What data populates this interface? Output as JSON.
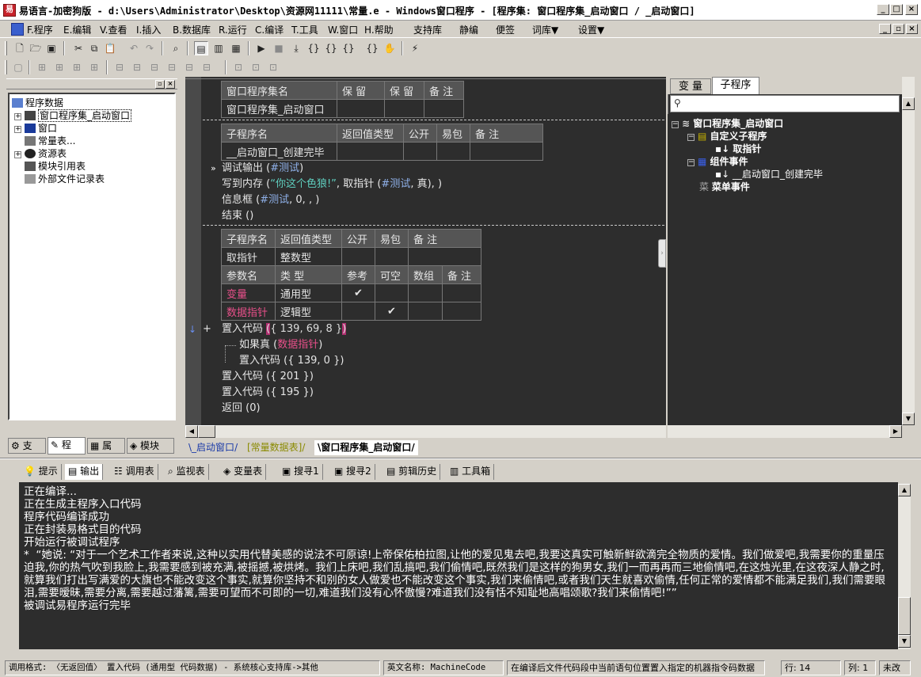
{
  "window": {
    "title": "易语言-加密狗版 - d:\\Users\\Administrator\\Desktop\\资源网11111\\常量.e - Windows窗口程序 - [程序集: 窗口程序集_启动窗口 / _启动窗口]"
  },
  "menu": [
    "F.程序",
    "E.编辑",
    "V.查看",
    "I.插入",
    "B.数据库",
    "R.运行",
    "C.编译",
    "T.工具",
    "W.窗口",
    "H.帮助",
    "支持库",
    "静编",
    "便签",
    "词库▼",
    "设置▼"
  ],
  "left_panel": {
    "tree": {
      "root": "程序数据",
      "items": [
        "窗口程序集_启动窗口",
        "窗口",
        "常量表...",
        "资源表",
        "模块引用表",
        "外部文件记录表"
      ]
    },
    "tabs": [
      "支",
      "程",
      "属",
      "模块"
    ]
  },
  "editor": {
    "class_table": {
      "headers": [
        "窗口程序集名",
        "保 留",
        "保 留",
        "备 注"
      ],
      "row": [
        "窗口程序集_启动窗口",
        "",
        "",
        ""
      ]
    },
    "sub1_table": {
      "headers": [
        "子程序名",
        "返回值类型",
        "公开",
        "易包",
        "备 注"
      ],
      "row": [
        "__启动窗口_创建完毕",
        "",
        "",
        "",
        ""
      ]
    },
    "sub1_code": {
      "line1_cmd": "调试输出",
      "line1_arg": "#测试",
      "line2_cmd": "写到内存",
      "line2_str": "“你这个色狼!”",
      "line2_mid": "取指针",
      "line2_arg": "#测试",
      "line2_end": "真),",
      "line3_cmd": "信息框",
      "line3_arg": "#测试",
      "line3_end": "0, , )",
      "line4": "结束 ()"
    },
    "sub2_table": {
      "headers": [
        "子程序名",
        "返回值类型",
        "公开",
        "易包",
        "备 注"
      ],
      "row": [
        "取指针",
        "整数型",
        "",
        "",
        ""
      ],
      "param_headers": [
        "参数名",
        "类 型",
        "参考",
        "可空",
        "数组",
        "备 注"
      ],
      "params": [
        {
          "name": "变量",
          "type": "通用型",
          "ref": "✔",
          "nullable": "",
          "array": "",
          "note": ""
        },
        {
          "name": "数据指针",
          "type": "逻辑型",
          "ref": "",
          "nullable": "✔",
          "array": "",
          "note": ""
        }
      ]
    },
    "sub2_code": {
      "l1_cmd": "置入代码",
      "l1_arg": "{ 139, 69, 8 }",
      "l2_cmd": "如果真",
      "l2_arg": "数据指针",
      "l3": "置入代码 ({ 139, 0 })",
      "l4": "置入代码 ({ 201 })",
      "l5": "置入代码 ({ 195 })",
      "l6": "返回 (0)"
    },
    "bottom_tabs": [
      "_启动窗口",
      "[常量数据表]",
      "窗口程序集_启动窗口"
    ]
  },
  "right_panel": {
    "tabs": [
      "变 量",
      "子程序"
    ],
    "tree": {
      "root": "窗口程序集_启动窗口",
      "custom": "自定义子程序",
      "custom_item": "取指针",
      "events": "组件事件",
      "event_item": "__启动窗口_创建完毕",
      "menu_events": "菜单事件"
    }
  },
  "output_tabs": [
    "提示",
    "输出",
    "调用表",
    "监视表",
    "变量表",
    "搜寻1",
    "搜寻2",
    "剪辑历史",
    "工具箱"
  ],
  "output_lines": [
    "正在编译...",
    "正在生成主程序入口代码",
    "程序代码编译成功",
    "正在封装易格式目的代码",
    "开始运行被调试程序",
    "*  “她说: “对于一个艺术工作者来说,这种以实用代替美感的说法不可原谅!上帝保佑柏拉图,让他的爱见鬼去吧,我要这真实可触新鲜欲滴完全物质的爱情。我们做爱吧,我需要你的重量压迫我,你的热气吹到我脸上,我需要感到被充满,被摇撼,被烘烤。我们上床吧,我们乱搞吧,我们偷情吧,既然我们是这样的狗男女,我们一而再再而三地偷情吧,在这烛光里,在这夜深人静之时,就算我们打出写满爱的大旗也不能改变这个事实,就算你坚持不和别的女人做爱也不能改变这个事实,我们来偷情吧,或者我们天生就喜欢偷情,任何正常的爱情都不能满足我们,我们需要眼泪,需要暧昧,需要分离,需要越过藩篱,需要可望而不可即的一切,难道我们没有心怀傲慢?难道我们没有恬不知耻地高唱颂歌?我们来偷情吧!””",
    "被调试易程序运行完毕"
  ],
  "status": {
    "hint": "调用格式: 〈无返回值〉 置入代码 (通用型 代码数据) - 系统核心支持库->其他",
    "english": "英文名称: MachineCode",
    "desc": "在编译后文件代码段中当前语句位置置入指定的机器指令码数据",
    "row": "行: 14",
    "col": "列: 1",
    "mode": "未改"
  }
}
